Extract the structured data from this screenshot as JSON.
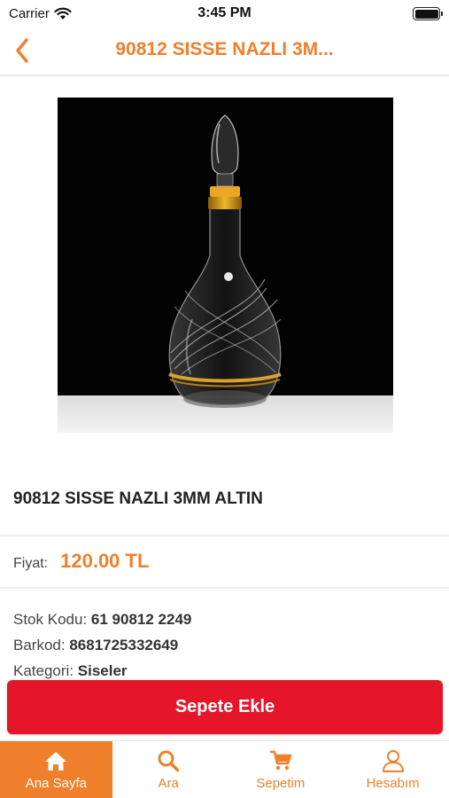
{
  "status_bar": {
    "carrier": "Carrier",
    "time": "3:45 PM",
    "icons": [
      "wifi-icon",
      "battery-icon"
    ]
  },
  "nav": {
    "back_icon": "chevron-left-icon",
    "title": "90812 SISSE NAZLI 3M..."
  },
  "product": {
    "image": "decanter-bottle-image",
    "name": "90812 SISSE NAZLI 3MM ALTIN",
    "price_label": "Fiyat:",
    "price_value": "120.00 TL",
    "details": [
      {
        "label": "Stok Kodu:",
        "value": "61 90812 2249"
      },
      {
        "label": "Barkod:",
        "value": "8681725332649"
      },
      {
        "label": "Kategori:",
        "value": "Siseler"
      }
    ]
  },
  "actions": {
    "add_to_cart": "Sepete Ekle"
  },
  "tabs": [
    {
      "label": "Ana Sayfa",
      "icon": "home-icon",
      "active": true
    },
    {
      "label": "Ara",
      "icon": "search-icon",
      "active": false
    },
    {
      "label": "Sepetim",
      "icon": "cart-icon",
      "active": false
    },
    {
      "label": "Hesabım",
      "icon": "user-icon",
      "active": false
    }
  ],
  "colors": {
    "accent": "#f07f2c",
    "cart_button": "#e5162a",
    "text": "#333333"
  }
}
